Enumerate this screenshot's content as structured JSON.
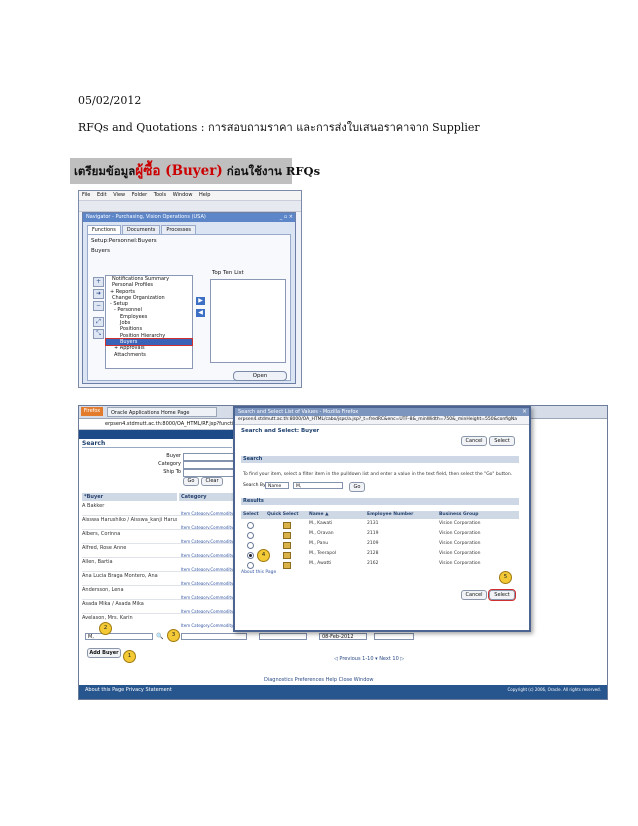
{
  "doc": {
    "date": "05/02/2012",
    "subtitle": "RFQs and Quotations : การสอบถามราคา และการส่งใบเสนอราคาจาก Supplier",
    "section_prefix": "เตรียมข้อมูล",
    "section_red": "ผู้ซื้อ (Buyer)",
    "section_suffix": " ก่อนใช้งาน RFQs"
  },
  "forms": {
    "menu": [
      "File",
      "Edit",
      "View",
      "Folder",
      "Tools",
      "Window",
      "Help"
    ],
    "window_title": "Navigator - Purchasing, Vision Operations (USA)",
    "tabs": [
      "Functions",
      "Documents",
      "Processes"
    ],
    "breadcrumb": "Setup:Personnel:Buyers",
    "current": "Buyers",
    "tree": [
      "Notifications Summary",
      "Personal Profiles",
      "+ Reports",
      "Change Organization",
      "- Setup",
      "- Personnel",
      "Employees",
      "Jobs",
      "Positions",
      "Position Hierarchy",
      "Buyers",
      "+ Approvals",
      "Attachments"
    ],
    "top_ten_label": "Top Ten List",
    "open_label": "Open"
  },
  "web": {
    "browser_tab": "Oracle Applications Home Page",
    "firefox": "Firefox",
    "url": "erpsen4.stdmutt.ac.th:8000/OA_HTML/RF.jsp?functio",
    "search_header": "Search",
    "labels": {
      "buyer": "Buyer",
      "category": "Category",
      "ship_to": "Ship To"
    },
    "go": "Go",
    "clear": "Clear",
    "col_buyer": "*Buyer",
    "col_category": "Category",
    "buyers": [
      "A Bakker",
      "Aisswa Harushiko / Aisswa_kanji Harushiko_kanji",
      "Albers, Corinna",
      "Alfred, Rose Anne",
      "Allen, Bartia",
      "Ana Lucia Braga Montero, Ana",
      "Andersson, Lena",
      "Asada Mika / Asada Mika",
      "Avelason, Mrs. Karin"
    ],
    "category_link": "Item Category.Commodity",
    "edit_value": "M,",
    "edit_date": "08-Feb-2012",
    "add_buyer": "Add Buyer",
    "pager": "◁ Previous  1-10  ▾  Next 10 ▷",
    "footer_about": "About this Page    Privacy Statement",
    "footer_links": "Diagnostics   Preferences   Help   Close Window",
    "footer_copy": "Copyright (c) 2006, Oracle. All rights reserved."
  },
  "dialog": {
    "title": "Search and Select List of Values - Mozilla Firefox",
    "url": "erpsen4.stdmutt.ac.th:8000/OA_HTML/cabo/jsps/a.jsp?_t=fredRC&enc=UTF-8&_minWidth=750&_minHeight=550&configNa",
    "heading": "Search and Select: Buyer",
    "cancel": "Cancel",
    "select": "Select",
    "search_section": "Search",
    "instructions": "To find your item, select a filter item in the pulldown list and enter a value in the text field, then select the \"Go\" button.",
    "search_by_label": "Search By",
    "search_by": "Name",
    "search_value": "M,",
    "go": "Go",
    "results_section": "Results",
    "columns": [
      "Select",
      "Quick Select",
      "Name ▲",
      "Employee Number",
      "Business Group"
    ],
    "rows": [
      {
        "name": "M., Kawati",
        "number": "2131",
        "group": "Vision Corporation",
        "selected": false
      },
      {
        "name": "M., Oravan",
        "number": "2119",
        "group": "Vision Corporation",
        "selected": false
      },
      {
        "name": "M., Panu",
        "number": "2109",
        "group": "Vision Corporation",
        "selected": false
      },
      {
        "name": "M., Teerapol",
        "number": "2128",
        "group": "Vision Corporation",
        "selected": true
      },
      {
        "name": "M., Awatti",
        "number": "2162",
        "group": "Vision Corporation",
        "selected": false
      }
    ],
    "about": "About this Page"
  },
  "callouts": [
    "1",
    "2",
    "3",
    "4",
    "5"
  ],
  "colors": {
    "oracle_blue": "#1d4b87",
    "section_red": "#cc0000",
    "callout": "#f3c936"
  }
}
